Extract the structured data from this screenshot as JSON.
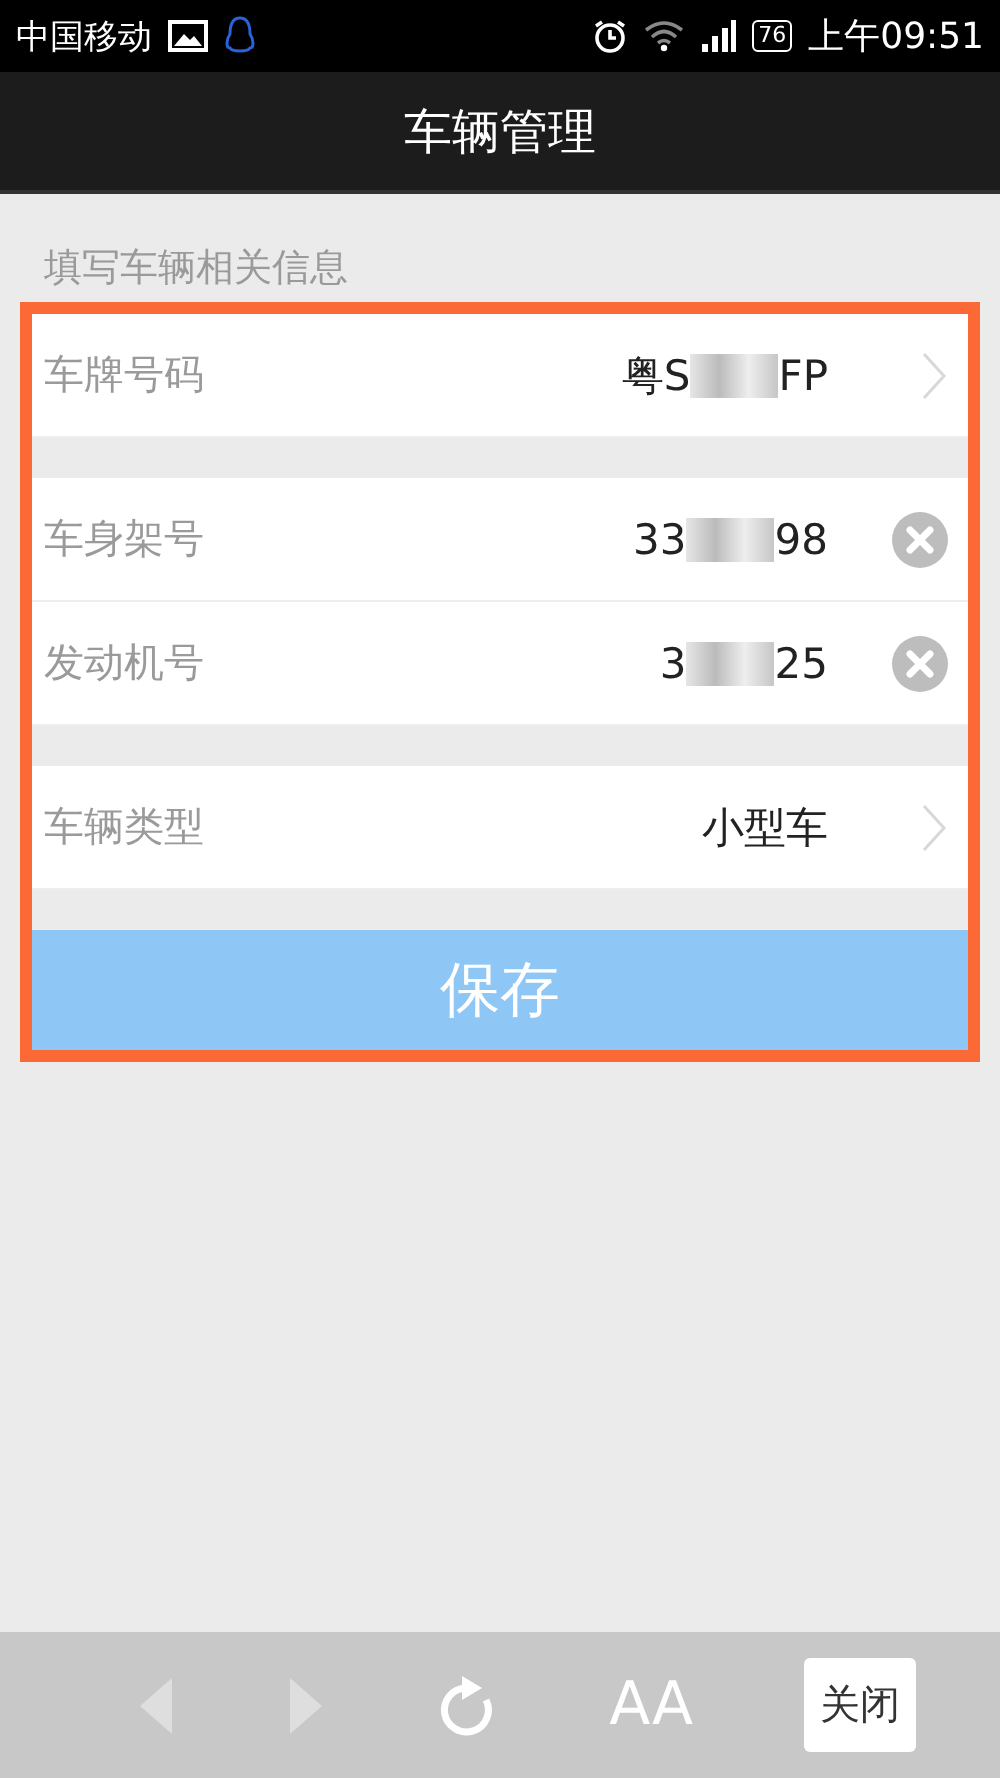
{
  "status_bar": {
    "carrier": "中国移动",
    "battery": "76",
    "time": "上午09:51"
  },
  "title": "车辆管理",
  "section_label": "填写车辆相关信息",
  "groups": [
    [
      {
        "label": "车牌号码",
        "value_start": "粤S",
        "value_end": "FP",
        "kind": "chevron"
      }
    ],
    [
      {
        "label": "车身架号",
        "value_start": "33",
        "value_end": "98",
        "kind": "clear"
      },
      {
        "label": "发动机号",
        "value_start": "3",
        "value_end": "25",
        "kind": "clear"
      }
    ],
    [
      {
        "label": "车辆类型",
        "value_start": "小型车",
        "kind": "chevron"
      }
    ]
  ],
  "save_button": "保存",
  "toolbar": {
    "font_size": "AA",
    "close": "关闭"
  }
}
